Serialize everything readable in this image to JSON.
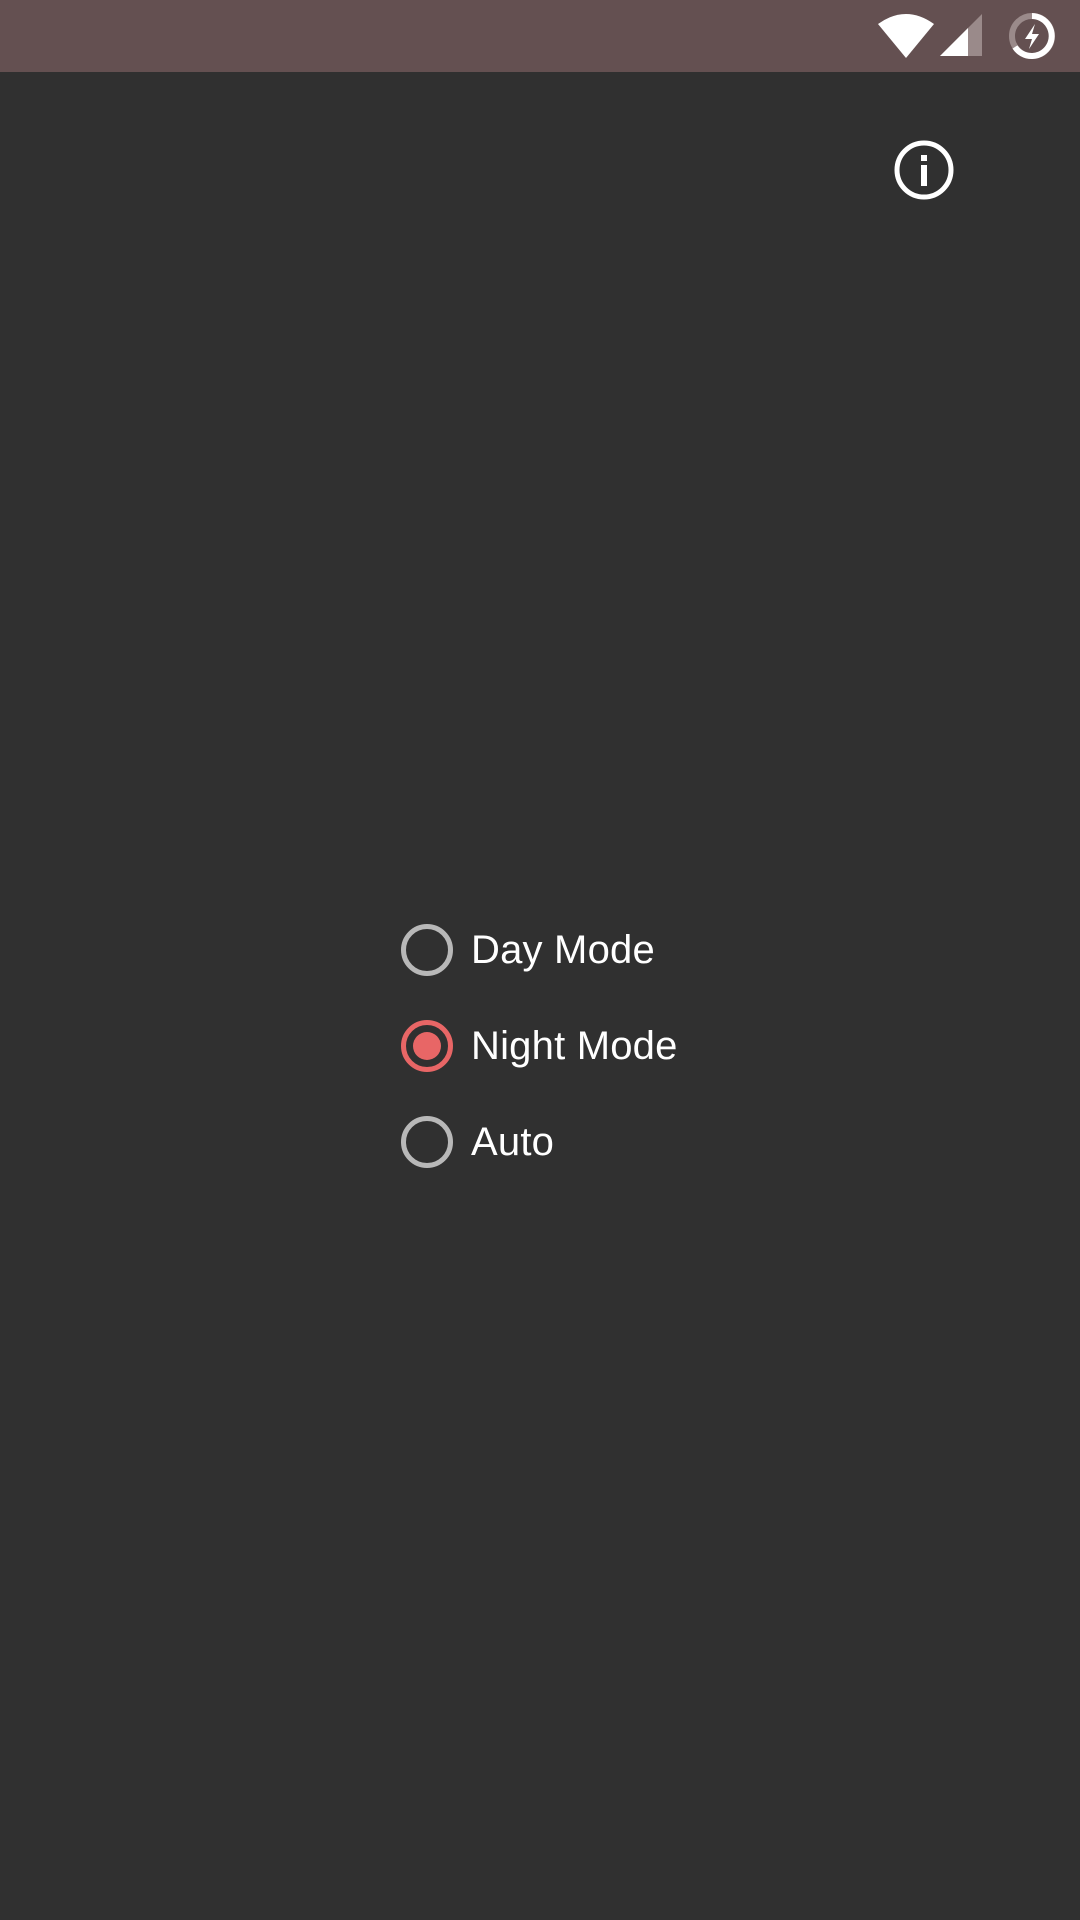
{
  "status_bar": {
    "color": "#645051",
    "icons": [
      "wifi-icon",
      "cellular-signal-icon",
      "battery-charging-icon"
    ]
  },
  "toolbar": {
    "info_icon": "info-icon"
  },
  "theme_options": {
    "accent_color": "#e86666",
    "selected": "Night Mode",
    "items": [
      {
        "label": "Day Mode",
        "checked": false
      },
      {
        "label": "Night Mode",
        "checked": true
      },
      {
        "label": "Auto",
        "checked": false
      }
    ]
  }
}
